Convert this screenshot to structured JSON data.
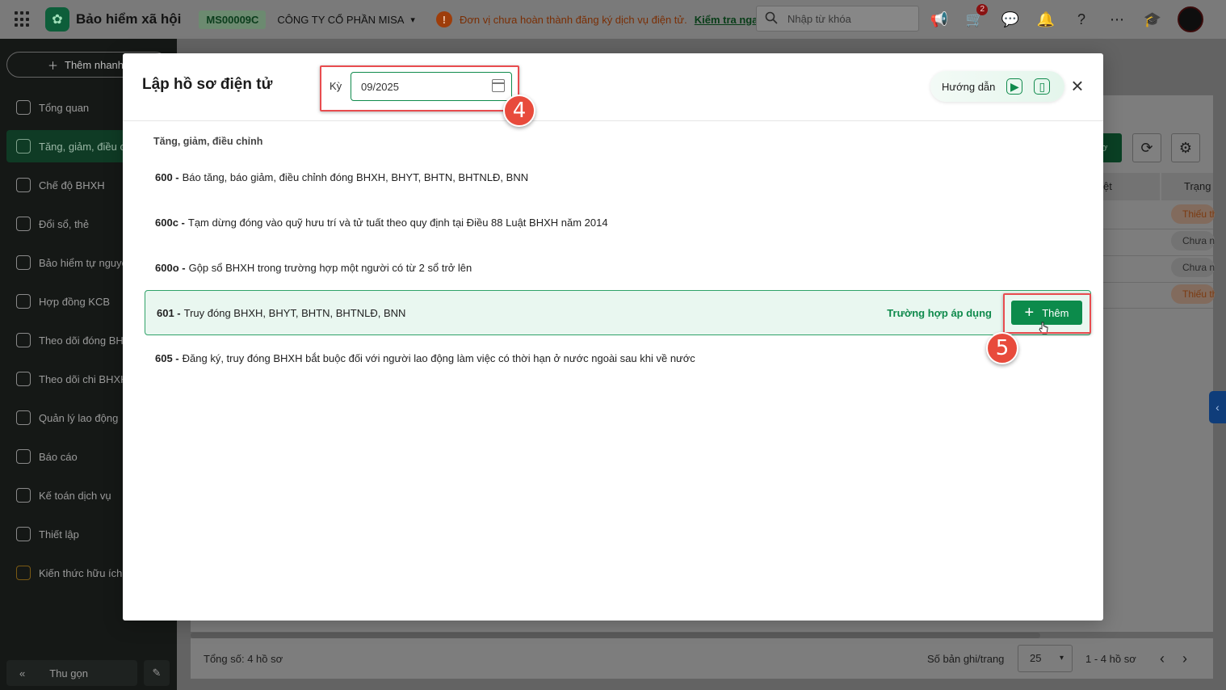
{
  "topbar": {
    "app_title": "Bảo hiểm xã hội",
    "company_code": "MS00009C",
    "company_name": "CÔNG TY CỔ PHẦN MISA",
    "warning_text": "Đơn vị chưa hoàn thành đăng ký dịch vụ điện tử.",
    "warning_link": "Kiểm tra ngay.",
    "search_placeholder": "Nhập từ khóa",
    "cart_badge": "2"
  },
  "sidebar": {
    "quick_add": "Thêm nhanh",
    "items": [
      {
        "label": "Tổng quan"
      },
      {
        "label": "Tăng, giảm, điều chỉnh"
      },
      {
        "label": "Chế độ BHXH"
      },
      {
        "label": "Đổi sổ, thẻ"
      },
      {
        "label": "Bảo hiểm tự nguyện"
      },
      {
        "label": "Hợp đồng KCB"
      },
      {
        "label": "Theo dõi đóng BHXH"
      },
      {
        "label": "Theo dõi chi BHXH"
      },
      {
        "label": "Quản lý lao động"
      },
      {
        "label": "Báo cáo"
      },
      {
        "label": "Kế toán dịch vụ"
      },
      {
        "label": "Thiết lập"
      },
      {
        "label": "Kiến thức hữu ích"
      }
    ],
    "collapse_label": "Thu gọn"
  },
  "background": {
    "col_approve": "ệt",
    "col_status": "Trạng",
    "status_pills": [
      "Thiếu thông tin",
      "Chưa nộp",
      "Chưa nộp",
      "Thiếu thông tin"
    ],
    "footer_total": "Tổng số: 4 hồ sơ",
    "footer_per_page_label": "Số bản ghi/trang",
    "footer_per_page_value": "25",
    "footer_range": "1 - 4 hồ sơ"
  },
  "modal": {
    "title": "Lập hồ sơ điện tử",
    "period_label": "Kỳ",
    "period_value": "09/2025",
    "guide_label": "Hướng dẫn",
    "section_title": "Tăng, giảm, điều chỉnh",
    "forms": [
      {
        "code": "600 -",
        "desc": "Báo tăng, báo giảm, điều chỉnh đóng BHXH, BHYT, BHTN, BHTNLĐ, BNN"
      },
      {
        "code": "600c -",
        "desc": "Tạm dừng đóng vào quỹ hưu trí và tử tuất theo quy định tại Điều 88 Luật BHXH năm 2014"
      },
      {
        "code": "600o -",
        "desc": "Gộp sổ BHXH trong trường hợp một người có từ 2 sổ trở lên"
      },
      {
        "code": "601 -",
        "desc": "Truy đóng BHXH, BHYT, BHTN, BHTNLĐ, BNN"
      },
      {
        "code": "605 -",
        "desc": "Đăng ký, truy đóng BHXH bắt buộc đối với người lao động làm việc có thời hạn ở nước ngoài sau khi về nước"
      }
    ],
    "apply_link": "Trường hợp áp dụng",
    "add_button": "Thêm"
  },
  "annotations": {
    "step4": "4",
    "step5": "5"
  }
}
